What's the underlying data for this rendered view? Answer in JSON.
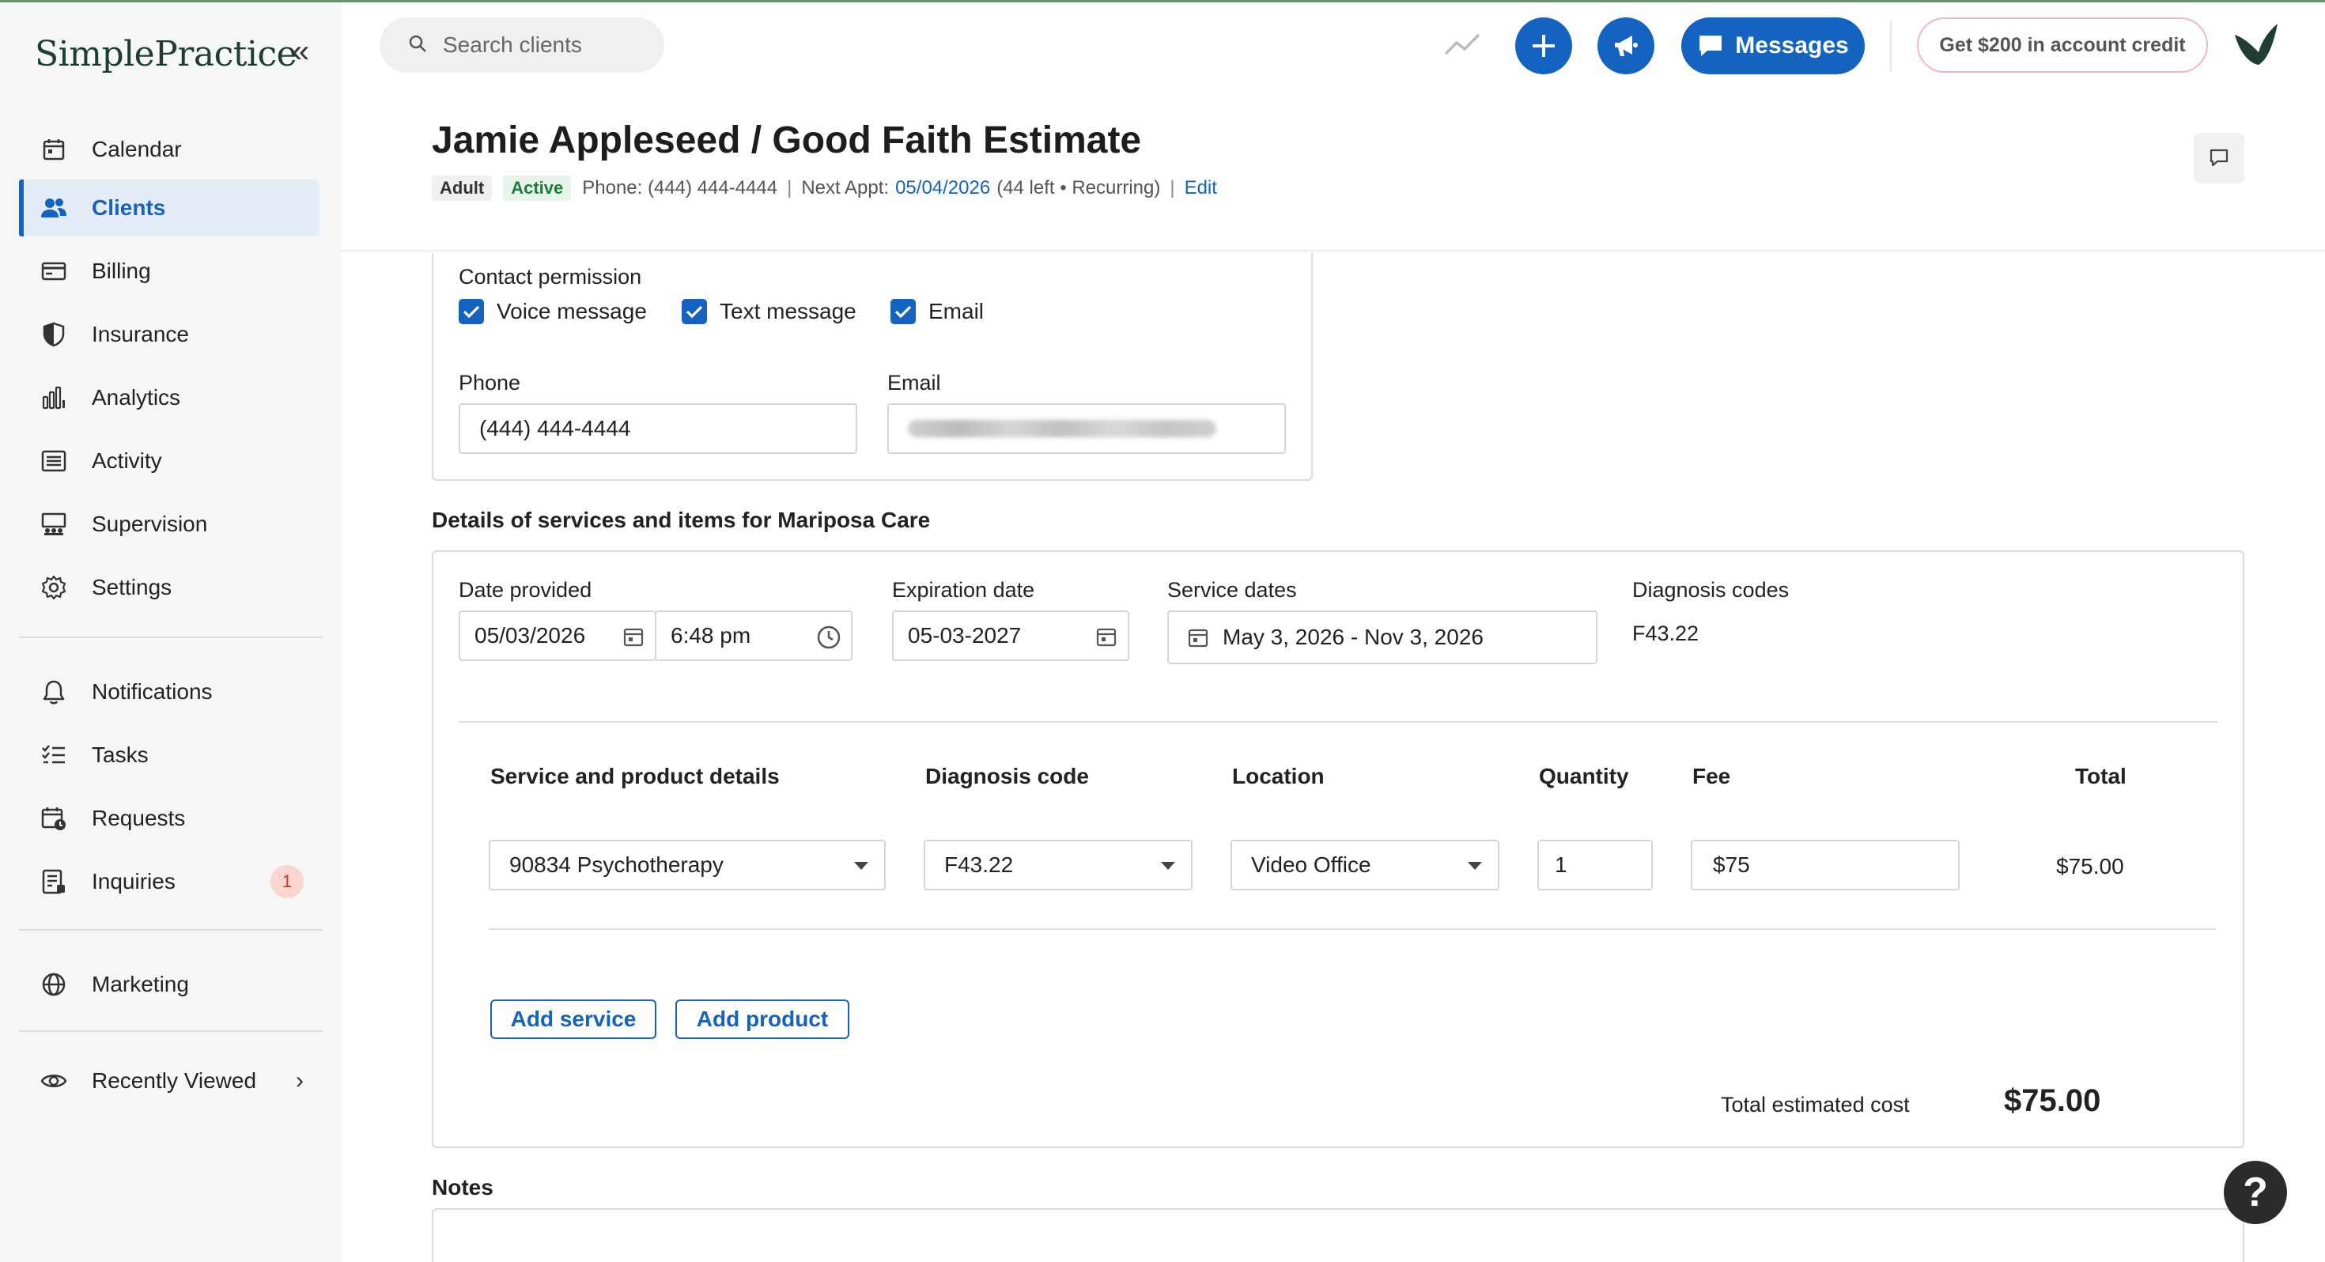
{
  "app": {
    "logo": "SimplePractice",
    "collapse_glyph": "«"
  },
  "sidebar": {
    "items": [
      {
        "label": "Calendar",
        "icon": "calendar-icon"
      },
      {
        "label": "Clients",
        "icon": "clients-icon",
        "active": true
      },
      {
        "label": "Billing",
        "icon": "billing-icon"
      },
      {
        "label": "Insurance",
        "icon": "insurance-icon"
      },
      {
        "label": "Analytics",
        "icon": "analytics-icon"
      },
      {
        "label": "Activity",
        "icon": "activity-icon"
      },
      {
        "label": "Supervision",
        "icon": "supervision-icon"
      },
      {
        "label": "Settings",
        "icon": "gear-icon"
      },
      {
        "label": "Notifications",
        "icon": "bell-icon"
      },
      {
        "label": "Tasks",
        "icon": "tasks-icon"
      },
      {
        "label": "Requests",
        "icon": "requests-icon"
      },
      {
        "label": "Inquiries",
        "icon": "inquiries-icon",
        "badge": "1"
      },
      {
        "label": "Marketing",
        "icon": "globe-icon"
      },
      {
        "label": "Recently Viewed",
        "icon": "eye-icon"
      }
    ]
  },
  "topbar": {
    "search_placeholder": "Search clients",
    "messages_label": "Messages",
    "credit_label": "Get $200 in account credit"
  },
  "header": {
    "title": "Jamie Appleseed / Good Faith Estimate",
    "tag_adult": "Adult",
    "tag_active": "Active",
    "phone": "Phone: (444) 444-4444",
    "sep": "|",
    "next_appt_label": "Next Appt:",
    "next_appt_date": "05/04/2026",
    "next_appt_extra": "(44 left • Recurring)",
    "edit": "Edit"
  },
  "contact": {
    "permission_label": "Contact permission",
    "voice": "Voice message",
    "text": "Text message",
    "email_opt": "Email",
    "phone_label": "Phone",
    "phone_value": "(444) 444-4444",
    "email_label": "Email"
  },
  "services": {
    "section_title": "Details of services and items for Mariposa Care",
    "date_provided_label": "Date provided",
    "date_provided": "05/03/2026",
    "time_provided": "6:48 pm",
    "expiration_label": "Expiration date",
    "expiration": "05-03-2027",
    "service_dates_label": "Service dates",
    "service_dates": "May 3, 2026 - Nov 3, 2026",
    "diagnosis_codes_label": "Diagnosis codes",
    "diagnosis_codes": "F43.22",
    "columns": {
      "service": "Service and product details",
      "diagnosis": "Diagnosis code",
      "location": "Location",
      "quantity": "Quantity",
      "fee": "Fee",
      "total": "Total"
    },
    "row": {
      "service": "90834 Psychotherapy",
      "diagnosis": "F43.22",
      "location": "Video Office",
      "quantity": "1",
      "fee": "$75",
      "total": "$75.00"
    },
    "add_service": "Add service",
    "add_product": "Add product",
    "total_label": "Total estimated cost",
    "total_value": "$75.00"
  },
  "notes": {
    "label": "Notes"
  },
  "help_glyph": "?",
  "colors": {
    "primary": "#1463c0",
    "active_tag_bg": "#e6f4ea",
    "badge_bg": "#fbd6d0"
  }
}
